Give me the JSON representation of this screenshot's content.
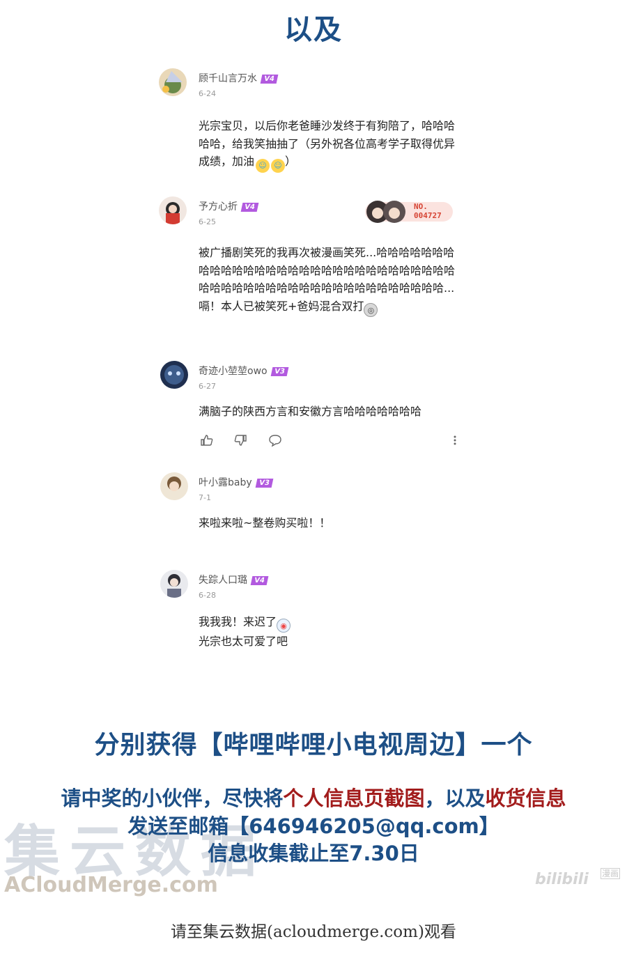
{
  "top_heading": "以及",
  "comments": [
    {
      "user": "顾千山言万水",
      "level": "V4",
      "date": "6-24",
      "text": "光宗宝贝，以后你老爸睡沙发终于有狗陪了，哈哈哈哈哈，给我笑抽抽了（另外祝各位高考学子取得优异成绩，加油",
      "text_end": "）"
    },
    {
      "user": "予方心折",
      "level": "V4",
      "date": "6-25",
      "text": "被广播剧笑死的我再次被漫画笑死...哈哈哈哈哈哈哈哈哈哈哈哈哈哈哈哈哈哈哈哈哈哈哈哈哈哈哈哈哈哈哈哈哈哈哈哈哈哈哈哈哈哈哈哈哈哈哈哈哈哈哈哈...嗝！本人已被笑死+爸妈混合双打",
      "fan_badge_no": "NO.",
      "fan_badge_num": "004727"
    },
    {
      "user": "奇迹小堃堃owo",
      "level": "V3",
      "date": "6-27",
      "text": "满脑子的陕西方言和安徽方言哈哈哈哈哈哈哈"
    },
    {
      "user": "叶小露baby",
      "level": "V3",
      "date": "7-1",
      "text": "来啦来啦~整卷购买啦！！"
    },
    {
      "user": "失踪人口璐",
      "level": "V4",
      "date": "6-28",
      "text_line1": "我我我！来迟了",
      "text_line2": "光宗也太可爱了吧"
    }
  ],
  "prize_heading": "分别获得【哔哩哔哩小电视周边】一个",
  "notice": {
    "line1_part1": "请中奖的小伙伴，尽快将",
    "line1_part2": "个人信息页截图",
    "line1_part3": "，以及",
    "line1_part4": "收货信息",
    "line2": "发送至邮箱【646946205@qq.com】",
    "line3": "信息收集截止至7.30日"
  },
  "watermark_cn": "集云数据",
  "watermark_en": "ACloudMerge.com",
  "bilibili_logo": "bilibili",
  "bilibili_manhua": "漫画",
  "footer": "请至集云数据(acloudmerge.com)观看",
  "icons": {
    "like": "thumbs-up-icon",
    "dislike": "thumbs-down-icon",
    "reply": "reply-bubble-icon",
    "more": "more-vertical-icon"
  },
  "colors": {
    "heading_blue": "#1d4f86",
    "highlight_red": "#a21c1c",
    "level_badge": "#b25adf"
  }
}
